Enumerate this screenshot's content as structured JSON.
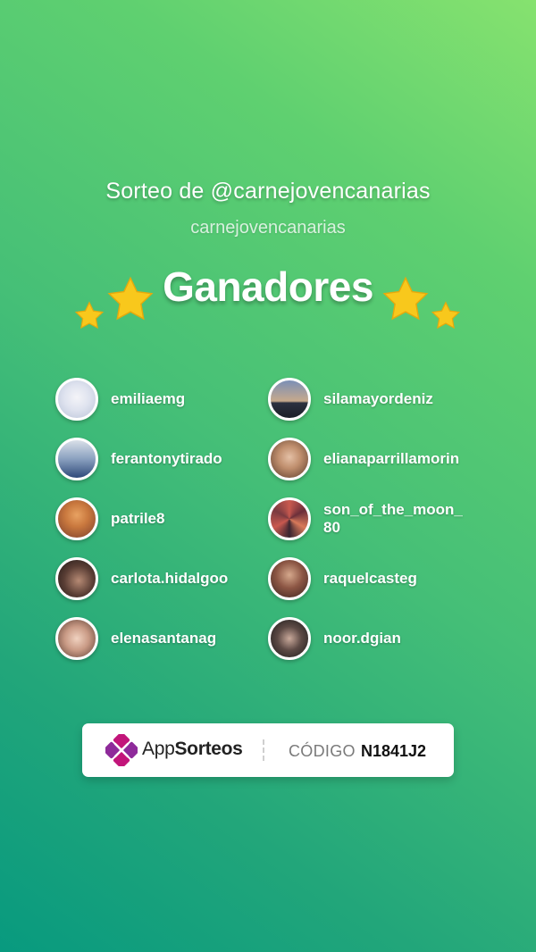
{
  "header": {
    "title": "Sorteo de @carnejovencanarias",
    "subtitle": "carnejovencanarias",
    "heading": "Ganadores"
  },
  "winners": [
    {
      "username": "emiliaemg",
      "avatar": "avatar-icon"
    },
    {
      "username": "silamayordeniz",
      "avatar": "avatar-icon"
    },
    {
      "username": "ferantonytirado",
      "avatar": "avatar-icon"
    },
    {
      "username": "elianaparrillamorin",
      "avatar": "avatar-icon"
    },
    {
      "username": "patrile8",
      "avatar": "avatar-icon"
    },
    {
      "username": "son_of_the_moon_80",
      "avatar": "avatar-icon"
    },
    {
      "username": "carlota.hidalgoo",
      "avatar": "avatar-icon"
    },
    {
      "username": "raquelcasteg",
      "avatar": "avatar-icon"
    },
    {
      "username": "elenasantanag",
      "avatar": "avatar-icon"
    },
    {
      "username": "noor.dgian",
      "avatar": "avatar-icon"
    }
  ],
  "footer": {
    "brand_prefix": "App",
    "brand_suffix": "Sorteos",
    "code_label": "CÓDIGO",
    "code_value": "N1841J2"
  },
  "colors": {
    "gradient_top": "#86e26f",
    "gradient_bottom": "#089a7f",
    "star": "#f8c81c",
    "brand_magenta": "#c2157a"
  }
}
